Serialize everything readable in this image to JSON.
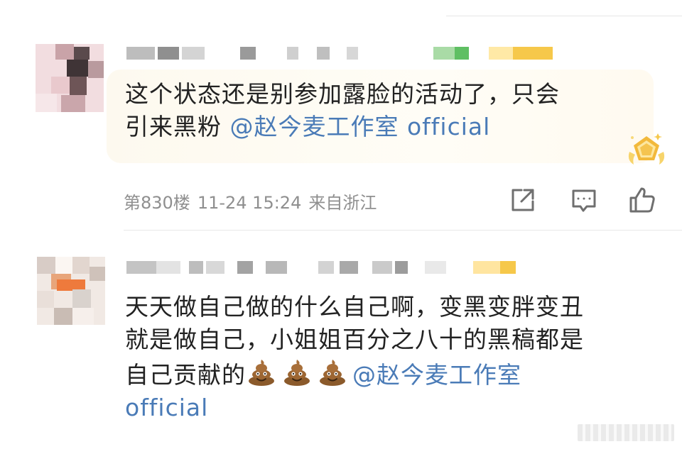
{
  "comments": [
    {
      "lines": [
        "这个状态还是别参加露脸的活动了，只会",
        "引来黑粉 "
      ],
      "mention": "@赵今麦工作室 official",
      "meta": {
        "floor": "第830楼",
        "time": "11-24 15:24",
        "location": "来自浙江"
      },
      "actions": [
        "share-icon",
        "comment-icon",
        "like-icon"
      ],
      "badge": "pentagon-medal-badge"
    },
    {
      "lines": [
        "天天做自己做的什么自己啊，变黑变胖变丑",
        "就是做自己，小姐姐百分之八十的黑稿都是",
        "自己贡献的"
      ],
      "emoji": "poop-emoji",
      "mention_line3": "@赵今麦工作室",
      "mention_line4": "official"
    }
  ],
  "colors": {
    "mention": "#4a7bb7",
    "meta_text": "#8f8f8f",
    "bubble": "#fdf9ef",
    "badge": "#f2c24a"
  }
}
